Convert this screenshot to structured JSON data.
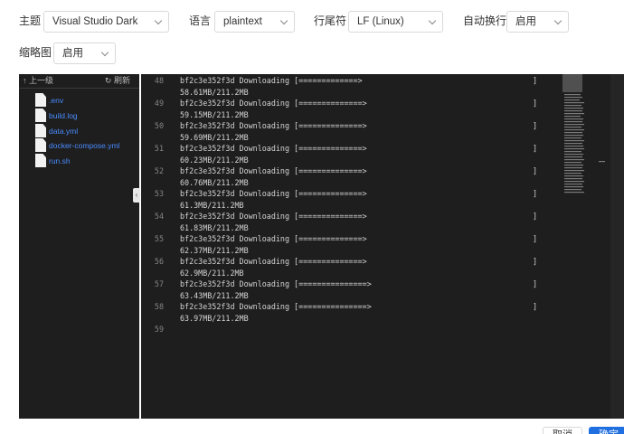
{
  "settings": {
    "theme": {
      "label": "主题",
      "value": "Visual Studio Dark"
    },
    "language": {
      "label": "语言",
      "value": "plaintext"
    },
    "line_ending": {
      "label": "行尾符",
      "value": "LF (Linux)"
    },
    "word_wrap": {
      "label": "自动换行",
      "value": "启用"
    },
    "minimap": {
      "label": "缩略图",
      "value": "启用"
    }
  },
  "tree": {
    "up_label": "上一级",
    "refresh_label": "刷新",
    "files": [
      ".env",
      "build.log",
      "data.yml",
      "docker-compose.yml",
      "run.sh"
    ]
  },
  "editor": {
    "lines": [
      {
        "num": "48",
        "text": "bf2c3e352f3d Downloading [=============>",
        "cont": "58.61MB/211.2MB",
        "end": "]"
      },
      {
        "num": "49",
        "text": "bf2c3e352f3d Downloading [==============>",
        "cont": "59.15MB/211.2MB",
        "end": "]"
      },
      {
        "num": "50",
        "text": "bf2c3e352f3d Downloading [==============>",
        "cont": "59.69MB/211.2MB",
        "end": "]"
      },
      {
        "num": "51",
        "text": "bf2c3e352f3d Downloading [==============>",
        "cont": "60.23MB/211.2MB",
        "end": "]"
      },
      {
        "num": "52",
        "text": "bf2c3e352f3d Downloading [==============>",
        "cont": "60.76MB/211.2MB",
        "end": "]"
      },
      {
        "num": "53",
        "text": "bf2c3e352f3d Downloading [==============>",
        "cont": "61.3MB/211.2MB",
        "end": "]"
      },
      {
        "num": "54",
        "text": "bf2c3e352f3d Downloading [==============>",
        "cont": "61.83MB/211.2MB",
        "end": "]"
      },
      {
        "num": "55",
        "text": "bf2c3e352f3d Downloading [==============>",
        "cont": "62.37MB/211.2MB",
        "end": "]"
      },
      {
        "num": "56",
        "text": "bf2c3e352f3d Downloading [==============>",
        "cont": "62.9MB/211.2MB",
        "end": "]"
      },
      {
        "num": "57",
        "text": "bf2c3e352f3d Downloading [===============>",
        "cont": "63.43MB/211.2MB",
        "end": "]"
      },
      {
        "num": "58",
        "text": "bf2c3e352f3d Downloading [===============>",
        "cont": "63.97MB/211.2MB",
        "end": "]"
      },
      {
        "num": "59",
        "text": "",
        "cont": "",
        "end": ""
      }
    ]
  },
  "footer": {
    "cancel_label": "取消",
    "ok_label": "确定"
  },
  "colors": {
    "editor_bg": "#1e1e1e",
    "accent": "#1f6fe0",
    "file_link": "#4a8cff"
  }
}
